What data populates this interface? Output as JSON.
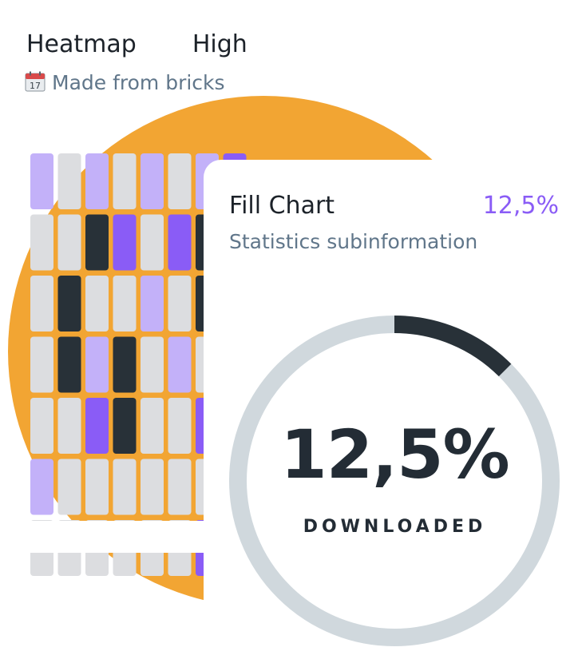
{
  "heatmap": {
    "title": "Heatmap",
    "level": "High",
    "subtitle": "Made from bricks",
    "calendar_day": "17",
    "icon": "calendar-icon",
    "colors": {
      "empty": "#dcdde0",
      "light": "#c3b1f9",
      "medium": "#8a5cf6",
      "dark": "#283138"
    }
  },
  "fill_chart": {
    "title": "Fill Chart",
    "value_label": "12,5%",
    "subtitle": "Statistics subinformation",
    "center_value": "12,5%",
    "center_label": "DOWNLOADED",
    "colors": {
      "track": "#d0d8dd",
      "fill": "#283138",
      "accent": "#8a5cf6"
    }
  },
  "accent_color": "#f2a533",
  "chart_data": [
    {
      "type": "heatmap",
      "title": "Heatmap",
      "subtitle": "Made from bricks",
      "levels": [
        "empty",
        "light",
        "medium",
        "dark"
      ],
      "rows": [
        [
          "light",
          "empty",
          "light",
          "empty",
          "light",
          "empty",
          "light",
          "medium"
        ],
        [
          "empty",
          "empty",
          "dark",
          "medium",
          "empty",
          "medium",
          "dark",
          "empty"
        ],
        [
          "empty",
          "dark",
          "empty",
          "empty",
          "light",
          "empty",
          "dark",
          "empty"
        ],
        [
          "empty",
          "dark",
          "light",
          "dark",
          "empty",
          "light",
          "empty",
          "empty"
        ],
        [
          "empty",
          "empty",
          "medium",
          "dark",
          "empty",
          "empty",
          "medium",
          "empty"
        ],
        [
          "light",
          "empty",
          "empty",
          "empty",
          "empty",
          "empty",
          "empty",
          "empty"
        ],
        [
          "empty",
          "empty",
          "empty",
          "empty",
          "empty",
          "empty",
          "medium",
          "empty"
        ]
      ]
    },
    {
      "type": "pie",
      "title": "Fill Chart",
      "subtitle": "Statistics subinformation",
      "value": 12.5,
      "max": 100,
      "unit": "%",
      "label": "DOWNLOADED"
    }
  ]
}
